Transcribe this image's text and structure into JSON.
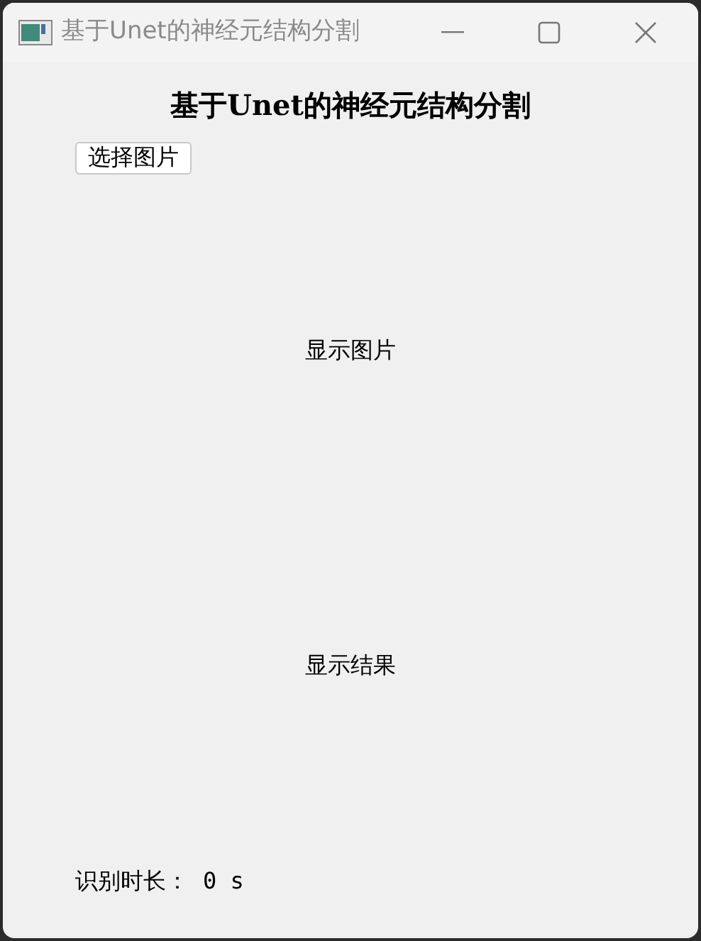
{
  "window": {
    "title": "基于Unet的神经元结构分割"
  },
  "heading": "基于Unet的神经元结构分割",
  "select_button": "选择图片",
  "image_area": {
    "label": "显示图片"
  },
  "result_area": {
    "label": "显示结果"
  },
  "duration": {
    "label": "识别时长：",
    "value": "0 s"
  }
}
